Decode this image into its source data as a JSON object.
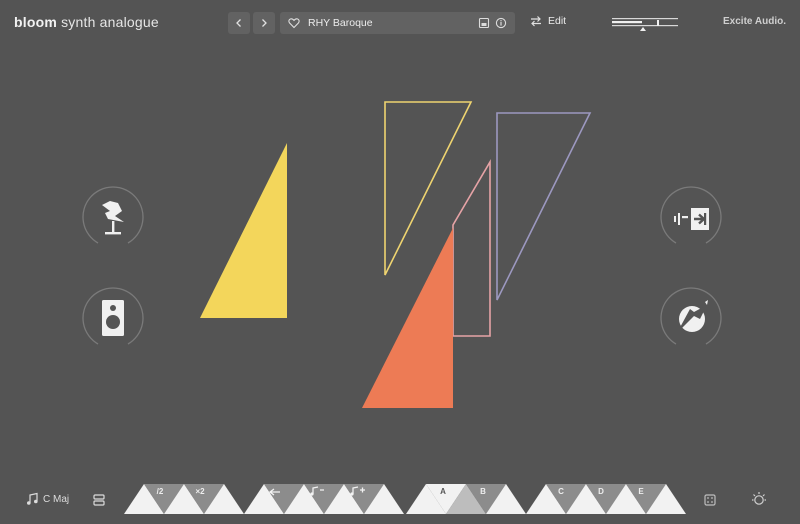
{
  "header": {
    "brand_bold": "bloom",
    "brand_rest": " synth analogue",
    "nav_prev_icon": "chevron-left-icon",
    "nav_next_icon": "chevron-right-icon",
    "preset_name": "RHY Baroque",
    "edit_label": "Edit",
    "vendor": "Excite Audio."
  },
  "bottom": {
    "key_label": "C Maj",
    "mod_labels": [
      "/2",
      "×2"
    ],
    "section_labels": [
      "A",
      "B",
      "C",
      "D",
      "E"
    ]
  },
  "colors": {
    "background": "#545454",
    "yellow": "#f3d65b",
    "orange": "#ed7b55",
    "pink_outline": "#e6a3a6",
    "violet_outline": "#9c98c0",
    "yellow_outline": "#efd470"
  }
}
